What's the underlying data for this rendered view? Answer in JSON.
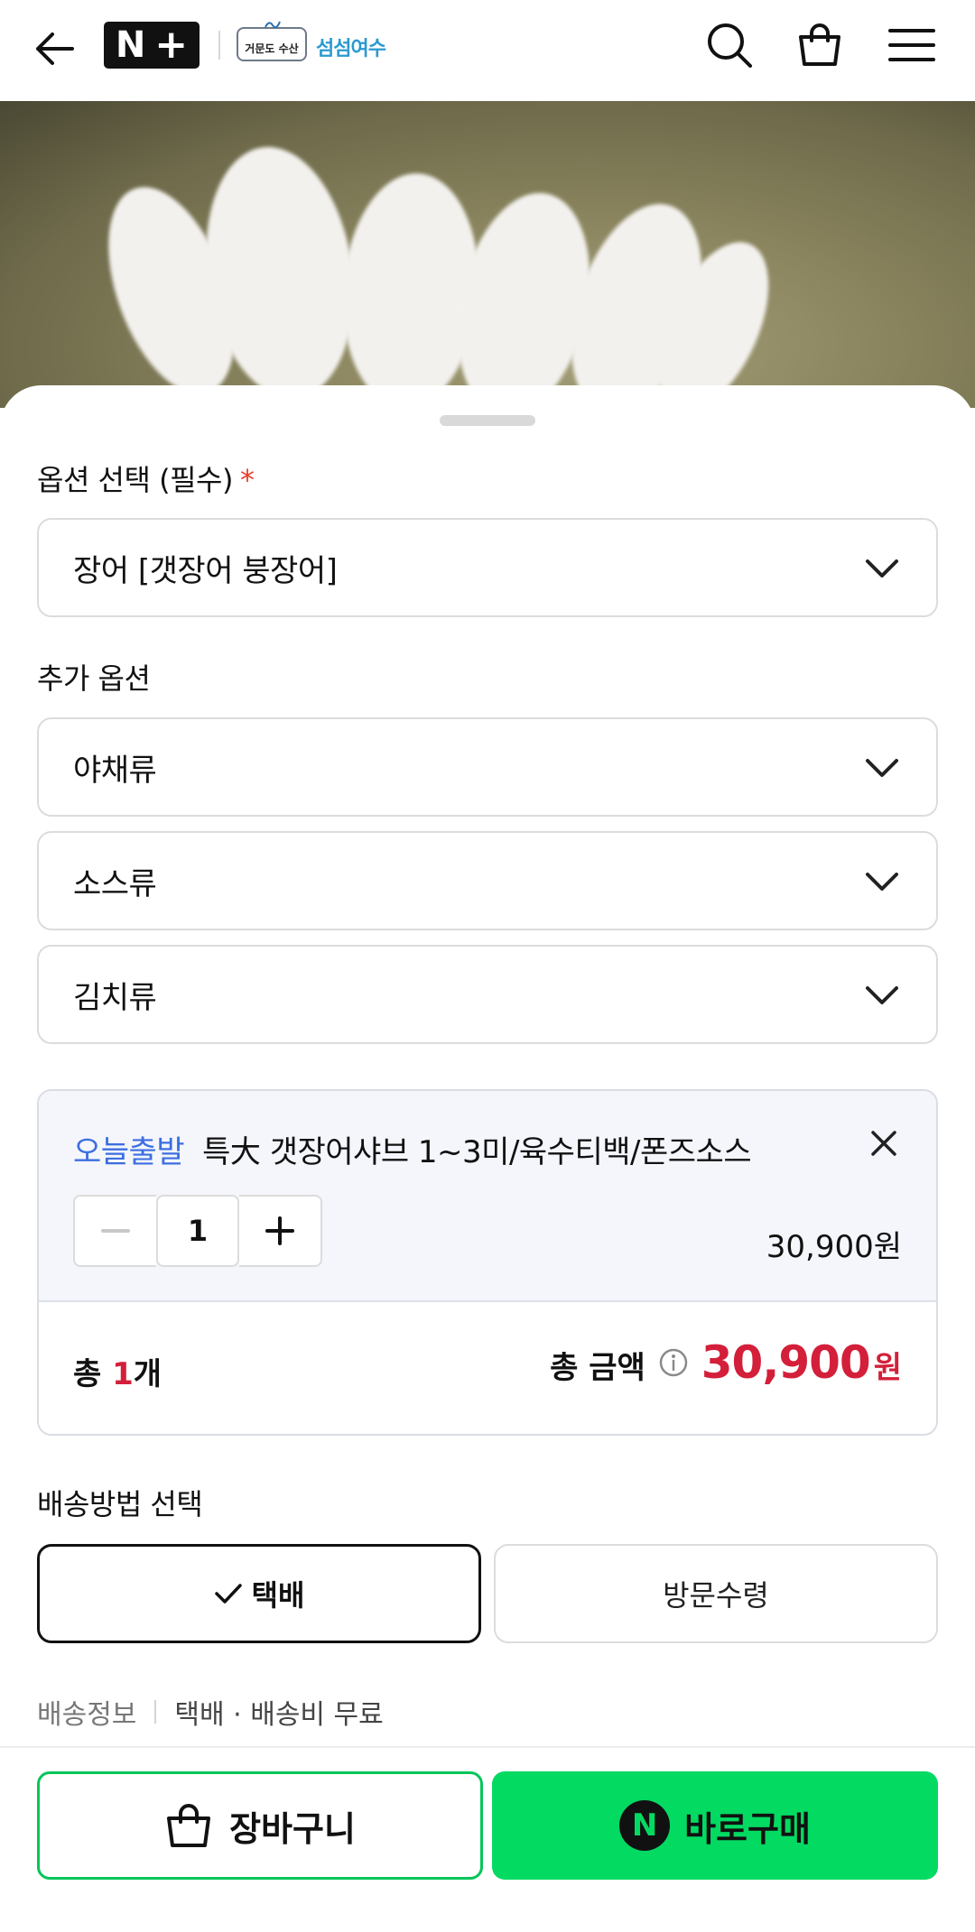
{
  "header": {
    "brand_badge": "N",
    "brand_logo_text": "거문도 수산",
    "brand_name": "섬섬여수",
    "icons": [
      "back-arrow-icon",
      "search-icon",
      "shopping-bag-icon",
      "menu-icon"
    ]
  },
  "option_section": {
    "label": "옵션 선택 (필수)",
    "required_mark": "*",
    "selected_value": "장어 [갯장어 붕장어]"
  },
  "additional_section": {
    "label": "추가 옵션",
    "selects": [
      {
        "value": "야채류"
      },
      {
        "value": "소스류"
      },
      {
        "value": "김치류"
      }
    ]
  },
  "selected_item": {
    "tag": "오늘출발",
    "name": "특大 갯장어샤브 1~3미/육수티백/폰즈소스",
    "quantity": "1",
    "price": "30,900원"
  },
  "totals": {
    "count_prefix": "총 ",
    "count": "1",
    "count_suffix": "개",
    "amount_label": "총 금액",
    "amount": "30,900",
    "currency": "원"
  },
  "delivery": {
    "label": "배송방법 선택",
    "options": [
      {
        "label": "택배",
        "selected": true
      },
      {
        "label": "방문수령",
        "selected": false
      }
    ],
    "info_key": "배송정보",
    "info_value": "택배 · 배송비 무료"
  },
  "actions": {
    "cart_label": "장바구니",
    "buy_label": "바로구매",
    "buy_badge": "N"
  },
  "colors": {
    "accent_red": "#d41f3a",
    "tag_blue": "#3c6ee0",
    "naver_green": "#03da62"
  }
}
